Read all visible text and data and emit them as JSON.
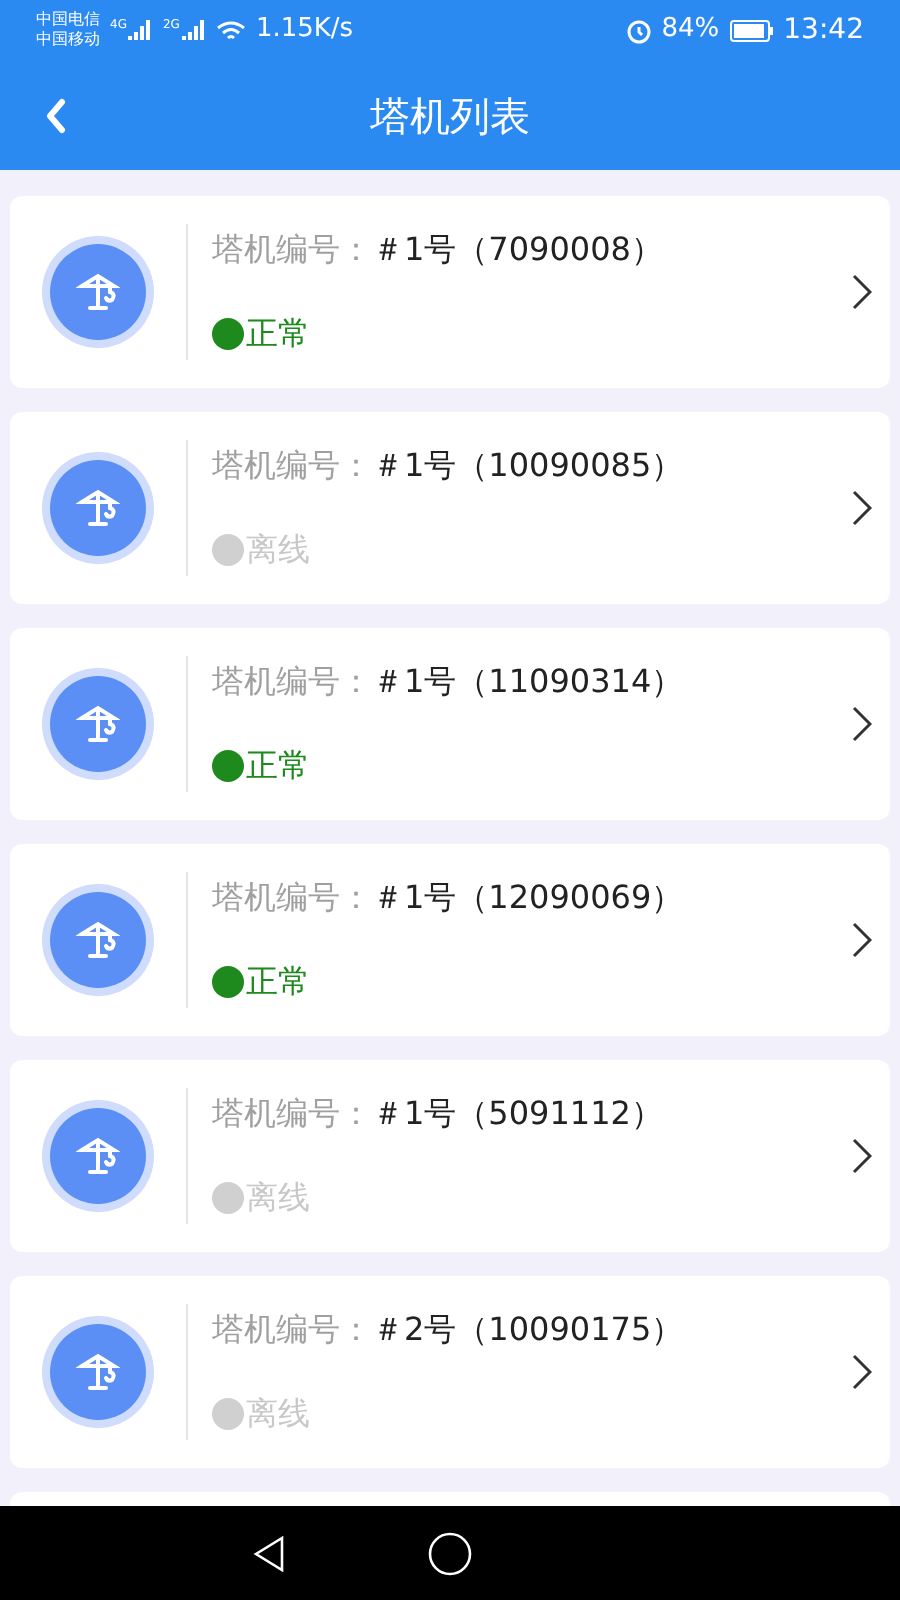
{
  "status_bar": {
    "carrier_1": "中国电信",
    "carrier_2": "中国移动",
    "signal_1": "4G",
    "signal_2": "2G",
    "speed": "1.15K/s",
    "battery": "84%",
    "time": "13:42"
  },
  "header": {
    "title": "塔机列表"
  },
  "cranes": [
    {
      "label": "塔机编号：",
      "number": "＃1号（7090008）",
      "status": "正常",
      "online": true
    },
    {
      "label": "塔机编号：",
      "number": "＃1号（10090085）",
      "status": "离线",
      "online": false
    },
    {
      "label": "塔机编号：",
      "number": "＃1号（11090314）",
      "status": "正常",
      "online": true
    },
    {
      "label": "塔机编号：",
      "number": "＃1号（12090069）",
      "status": "正常",
      "online": true
    },
    {
      "label": "塔机编号：",
      "number": "＃1号（5091112）",
      "status": "离线",
      "online": false
    },
    {
      "label": "塔机编号：",
      "number": "＃2号（10090175）",
      "status": "离线",
      "online": false
    }
  ]
}
